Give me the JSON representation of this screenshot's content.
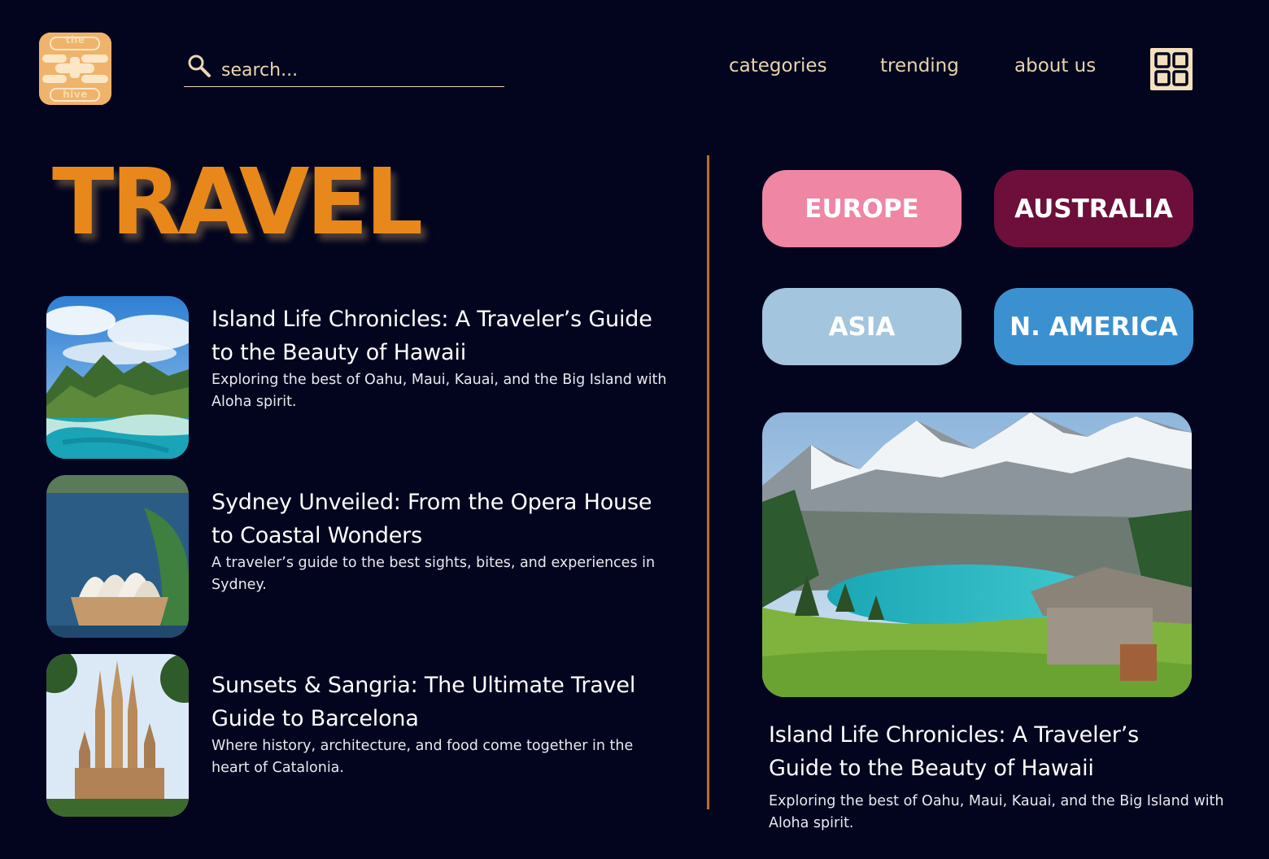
{
  "header": {
    "logo": {
      "top_text": "the",
      "bottom_text": "hive",
      "color": "#f0b36b"
    },
    "search": {
      "placeholder": "search...",
      "value": ""
    },
    "nav": [
      {
        "label": "categories"
      },
      {
        "label": "trending"
      },
      {
        "label": "about us"
      }
    ],
    "menu_icon": "grid-menu-icon"
  },
  "page": {
    "title": "TRAVEL",
    "accent_color": "#e8881a"
  },
  "articles": [
    {
      "title": "Island Life Chronicles: A Traveler’s Guide to the Beauty of Hawaii",
      "description": "Exploring the best of Oahu, Maui, Kauai, and the Big Island with Aloha spirit.",
      "image": "hawaii-coast"
    },
    {
      "title": "Sydney Unveiled: From the Opera House to Coastal Wonders",
      "description": "A traveler’s guide to the best sights, bites, and experiences in Sydney.",
      "image": "sydney-opera-house"
    },
    {
      "title": "Sunsets & Sangria: The Ultimate Travel Guide to Barcelona",
      "description": "Where history, architecture, and food come together in the heart of Catalonia.",
      "image": "sagrada-familia"
    }
  ],
  "regions": [
    {
      "label": "EUROPE",
      "color": "#ee86a4"
    },
    {
      "label": "AUSTRALIA",
      "color": "#6d0f3a"
    },
    {
      "label": "ASIA",
      "color": "#a3c5dd"
    },
    {
      "label": "N. AMERICA",
      "color": "#3b91d0"
    }
  ],
  "featured": {
    "title": "Island Life Chronicles: A Traveler’s Guide to the Beauty of Hawaii",
    "description": "Exploring the best of Oahu, Maui, Kauai, and the Big Island with Aloha spirit.",
    "image": "alpine-lake"
  }
}
